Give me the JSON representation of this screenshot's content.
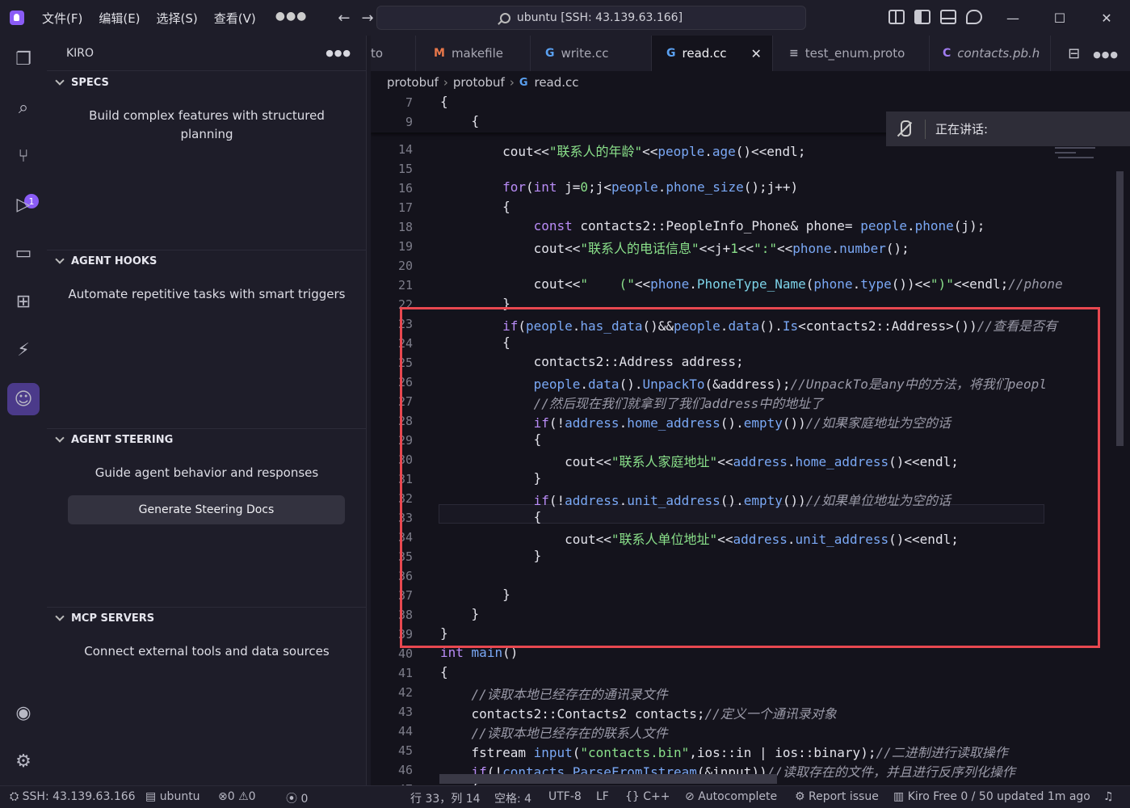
{
  "menu": [
    "文件(F)",
    "编辑(E)",
    "选择(S)",
    "查看(V)"
  ],
  "command_center": "ubuntu [SSH: 43.139.63.166]",
  "sidebar": {
    "title": "KIRO",
    "sections": [
      {
        "title": "SPECS",
        "desc": "Build complex features with structured planning"
      },
      {
        "title": "AGENT HOOKS",
        "desc": "Automate repetitive tasks with smart triggers"
      },
      {
        "title": "AGENT STEERING",
        "desc": "Guide agent behavior and responses",
        "button": "Generate Steering Docs"
      },
      {
        "title": "MCP SERVERS",
        "desc": "Connect external tools and data sources"
      }
    ]
  },
  "tabs": [
    {
      "icon": "",
      "label": "to",
      "icon_color": "#a8a8b4"
    },
    {
      "icon": "M",
      "label": "makefile",
      "icon_color": "#e8774a"
    },
    {
      "icon": "G",
      "label": "write.cc",
      "icon_color": "#5aa0f0"
    },
    {
      "icon": "G",
      "label": "read.cc",
      "icon_color": "#5aa0f0"
    },
    {
      "icon": "≡",
      "label": "test_enum.proto",
      "icon_color": "#c8c8d0"
    },
    {
      "icon": "C",
      "label": "contacts.pb.h",
      "icon_color": "#a07cf0"
    }
  ],
  "breadcrumb": [
    "protobuf",
    "protobuf",
    "read.cc"
  ],
  "badges": {
    "source_control": "1"
  },
  "speaking": "正在讲话:",
  "status": {
    "ssh": "SSH: 43.139.63.166",
    "host": "ubuntu",
    "errors": "0",
    "warnings": "0",
    "ports": "0",
    "position": "行 33，列 14",
    "spaces": "空格: 4",
    "encoding": "UTF-8",
    "eol": "LF",
    "language": "C++",
    "autocomplete": "Autocomplete",
    "report": "Report issue",
    "kiro": "Kiro Free 0 / 50 updated 1m ago"
  },
  "code_lines": [
    {
      "n": "7",
      "tokens": [
        [
          "p",
          "{"
        ]
      ]
    },
    {
      "n": "9",
      "tokens": [
        [
          "p",
          "    {"
        ]
      ]
    },
    {
      "n": "14",
      "tokens": [
        [
          "p",
          "        cout<<"
        ],
        [
          "s",
          "\"联系人的年龄\""
        ],
        [
          "p",
          "<<"
        ],
        [
          "f",
          "people"
        ],
        [
          "p",
          "."
        ],
        [
          "f",
          "age"
        ],
        [
          "p",
          "()<<endl;"
        ]
      ]
    },
    {
      "n": "15",
      "tokens": []
    },
    {
      "n": "16",
      "tokens": [
        [
          "p",
          "        "
        ],
        [
          "k",
          "for"
        ],
        [
          "p",
          "("
        ],
        [
          "k",
          "int"
        ],
        [
          "p",
          " j="
        ],
        [
          "s",
          "0"
        ],
        [
          "p",
          ";j<"
        ],
        [
          "f",
          "people"
        ],
        [
          "p",
          "."
        ],
        [
          "f",
          "phone_size"
        ],
        [
          "p",
          "();j++)"
        ]
      ]
    },
    {
      "n": "17",
      "tokens": [
        [
          "p",
          "        {"
        ]
      ]
    },
    {
      "n": "18",
      "tokens": [
        [
          "p",
          "            "
        ],
        [
          "k",
          "const"
        ],
        [
          "p",
          " contacts2::PeopleInfo_Phone& phone= "
        ],
        [
          "f",
          "people"
        ],
        [
          "p",
          "."
        ],
        [
          "f",
          "phone"
        ],
        [
          "p",
          "(j);"
        ]
      ]
    },
    {
      "n": "19",
      "tokens": [
        [
          "p",
          "            cout<<"
        ],
        [
          "s",
          "\"联系人的电话信息\""
        ],
        [
          "p",
          "<<j+"
        ],
        [
          "s",
          "1"
        ],
        [
          "p",
          "<<"
        ],
        [
          "s",
          "\":\""
        ],
        [
          "p",
          "<<"
        ],
        [
          "f",
          "phone"
        ],
        [
          "p",
          "."
        ],
        [
          "f",
          "number"
        ],
        [
          "p",
          "();"
        ]
      ]
    },
    {
      "n": "20",
      "tokens": []
    },
    {
      "n": "21",
      "tokens": [
        [
          "p",
          "            cout<<"
        ],
        [
          "s",
          "\"    (\""
        ],
        [
          "p",
          "<<"
        ],
        [
          "f",
          "phone"
        ],
        [
          "p",
          "."
        ],
        [
          "t",
          "PhoneType_Name"
        ],
        [
          "p",
          "("
        ],
        [
          "f",
          "phone"
        ],
        [
          "p",
          "."
        ],
        [
          "f",
          "type"
        ],
        [
          "p",
          "())<<"
        ],
        [
          "s",
          "\")\""
        ],
        [
          "p",
          "<<endl;"
        ],
        [
          "c",
          "//phone"
        ]
      ]
    },
    {
      "n": "22",
      "tokens": [
        [
          "p",
          "        }"
        ]
      ]
    },
    {
      "n": "23",
      "tokens": [
        [
          "p",
          "        "
        ],
        [
          "k",
          "if"
        ],
        [
          "p",
          "("
        ],
        [
          "f",
          "people"
        ],
        [
          "p",
          "."
        ],
        [
          "f",
          "has_data"
        ],
        [
          "p",
          "()&&"
        ],
        [
          "f",
          "people"
        ],
        [
          "p",
          "."
        ],
        [
          "f",
          "data"
        ],
        [
          "p",
          "()."
        ],
        [
          "f",
          "Is"
        ],
        [
          "p",
          "<contacts2::Address>())"
        ],
        [
          "c",
          "//查看是否有"
        ]
      ]
    },
    {
      "n": "24",
      "tokens": [
        [
          "p",
          "        {"
        ]
      ]
    },
    {
      "n": "25",
      "tokens": [
        [
          "p",
          "            contacts2::Address address;"
        ]
      ]
    },
    {
      "n": "26",
      "tokens": [
        [
          "p",
          "            "
        ],
        [
          "f",
          "people"
        ],
        [
          "p",
          "."
        ],
        [
          "f",
          "data"
        ],
        [
          "p",
          "()."
        ],
        [
          "f",
          "UnpackTo"
        ],
        [
          "p",
          "(&address);"
        ],
        [
          "c",
          "//UnpackTo是any中的方法，将我们peopl"
        ]
      ]
    },
    {
      "n": "27",
      "tokens": [
        [
          "p",
          "            "
        ],
        [
          "c",
          "//然后现在我们就拿到了我们address中的地址了"
        ]
      ]
    },
    {
      "n": "28",
      "tokens": [
        [
          "p",
          "            "
        ],
        [
          "k",
          "if"
        ],
        [
          "p",
          "(!"
        ],
        [
          "f",
          "address"
        ],
        [
          "p",
          "."
        ],
        [
          "f",
          "home_address"
        ],
        [
          "p",
          "()."
        ],
        [
          "f",
          "empty"
        ],
        [
          "p",
          "())"
        ],
        [
          "c",
          "//如果家庭地址为空的话"
        ]
      ]
    },
    {
      "n": "29",
      "tokens": [
        [
          "p",
          "            {"
        ]
      ]
    },
    {
      "n": "30",
      "tokens": [
        [
          "p",
          "                cout<<"
        ],
        [
          "s",
          "\"联系人家庭地址\""
        ],
        [
          "p",
          "<<"
        ],
        [
          "f",
          "address"
        ],
        [
          "p",
          "."
        ],
        [
          "f",
          "home_address"
        ],
        [
          "p",
          "()<<endl;"
        ]
      ]
    },
    {
      "n": "31",
      "tokens": [
        [
          "p",
          "            }"
        ]
      ]
    },
    {
      "n": "32",
      "tokens": [
        [
          "p",
          "            "
        ],
        [
          "k",
          "if"
        ],
        [
          "p",
          "(!"
        ],
        [
          "f",
          "address"
        ],
        [
          "p",
          "."
        ],
        [
          "f",
          "unit_address"
        ],
        [
          "p",
          "()."
        ],
        [
          "f",
          "empty"
        ],
        [
          "p",
          "())"
        ],
        [
          "c",
          "//如果单位地址为空的话"
        ]
      ]
    },
    {
      "n": "33",
      "tokens": [
        [
          "p",
          "            {"
        ]
      ]
    },
    {
      "n": "34",
      "tokens": [
        [
          "p",
          "                cout<<"
        ],
        [
          "s",
          "\"联系人单位地址\""
        ],
        [
          "p",
          "<<"
        ],
        [
          "f",
          "address"
        ],
        [
          "p",
          "."
        ],
        [
          "f",
          "unit_address"
        ],
        [
          "p",
          "()<<endl;"
        ]
      ]
    },
    {
      "n": "35",
      "tokens": [
        [
          "p",
          "            }"
        ]
      ]
    },
    {
      "n": "36",
      "tokens": []
    },
    {
      "n": "37",
      "tokens": [
        [
          "p",
          "        }"
        ]
      ]
    },
    {
      "n": "38",
      "tokens": [
        [
          "p",
          "    }"
        ]
      ]
    },
    {
      "n": "39",
      "tokens": [
        [
          "p",
          "}"
        ]
      ]
    },
    {
      "n": "40",
      "tokens": [
        [
          "k",
          "int"
        ],
        [
          "p",
          " "
        ],
        [
          "f",
          "main"
        ],
        [
          "p",
          "()"
        ]
      ]
    },
    {
      "n": "41",
      "tokens": [
        [
          "p",
          "{"
        ]
      ]
    },
    {
      "n": "42",
      "tokens": [
        [
          "p",
          "    "
        ],
        [
          "c",
          "//读取本地已经存在的通讯录文件"
        ]
      ]
    },
    {
      "n": "43",
      "tokens": [
        [
          "p",
          "    contacts2::Contacts2 contacts;"
        ],
        [
          "c",
          "//定义一个通讯录对象"
        ]
      ]
    },
    {
      "n": "44",
      "tokens": [
        [
          "p",
          "    "
        ],
        [
          "c",
          "//读取本地已经存在的联系人文件"
        ]
      ]
    },
    {
      "n": "45",
      "tokens": [
        [
          "p",
          "    fstream "
        ],
        [
          "f",
          "input"
        ],
        [
          "p",
          "("
        ],
        [
          "s",
          "\"contacts.bin\""
        ],
        [
          "p",
          ",ios::in | ios::binary);"
        ],
        [
          "c",
          "//二进制进行读取操作"
        ]
      ]
    },
    {
      "n": "46",
      "tokens": [
        [
          "p",
          "    "
        ],
        [
          "k",
          "if"
        ],
        [
          "p",
          "(!"
        ],
        [
          "f",
          "contacts"
        ],
        [
          "p",
          "."
        ],
        [
          "f",
          "ParseFromIstream"
        ],
        [
          "p",
          "(&input))"
        ],
        [
          "c",
          "//读取存在的文件，并且进行反序列化操作"
        ]
      ]
    },
    {
      "n": "47",
      "tokens": [
        [
          "p",
          "    {"
        ]
      ]
    }
  ]
}
